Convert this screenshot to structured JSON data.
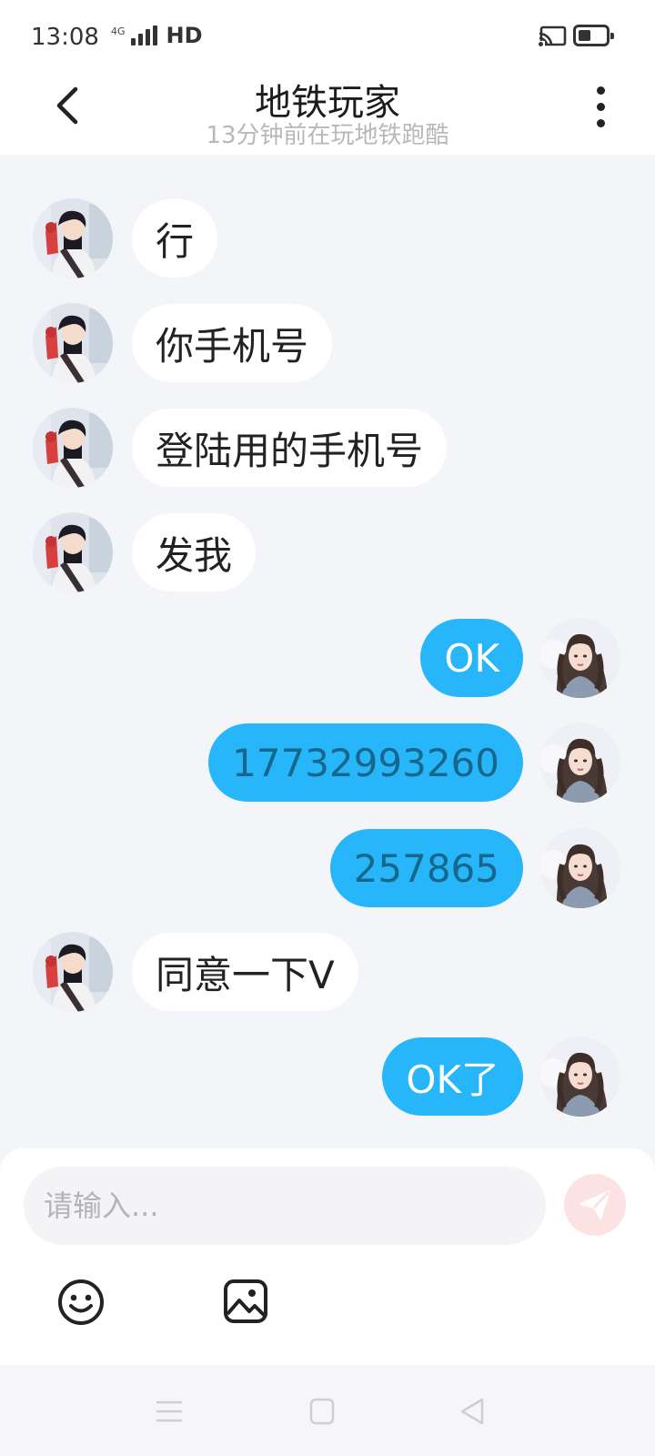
{
  "status_bar": {
    "time": "13:08",
    "network": "4G",
    "hd": "HD",
    "battery_level": 0.45
  },
  "header": {
    "title": "地铁玩家",
    "subtitle": "13分钟前在玩地铁跑酷"
  },
  "messages": [
    {
      "side": "in",
      "text": "行"
    },
    {
      "side": "in",
      "text": "你手机号"
    },
    {
      "side": "in",
      "text": "登陆用的手机号"
    },
    {
      "side": "in",
      "text": "发我"
    },
    {
      "side": "out",
      "text": "OK"
    },
    {
      "side": "out",
      "text": "17732993260"
    },
    {
      "side": "out",
      "text": "257865"
    },
    {
      "side": "in",
      "text": "同意一下V"
    },
    {
      "side": "out",
      "text": "OK了"
    }
  ],
  "input": {
    "placeholder": "请输入..."
  },
  "colors": {
    "outgoing_bubble": "#28b6fb",
    "incoming_bubble": "#ffffff",
    "background": "#f4f5f9",
    "send_button": "#fde2e4"
  },
  "icons": [
    "back-icon",
    "more-icon",
    "send-icon",
    "emoji-icon",
    "image-icon",
    "menu-icon",
    "home-icon",
    "back-triangle-icon"
  ]
}
